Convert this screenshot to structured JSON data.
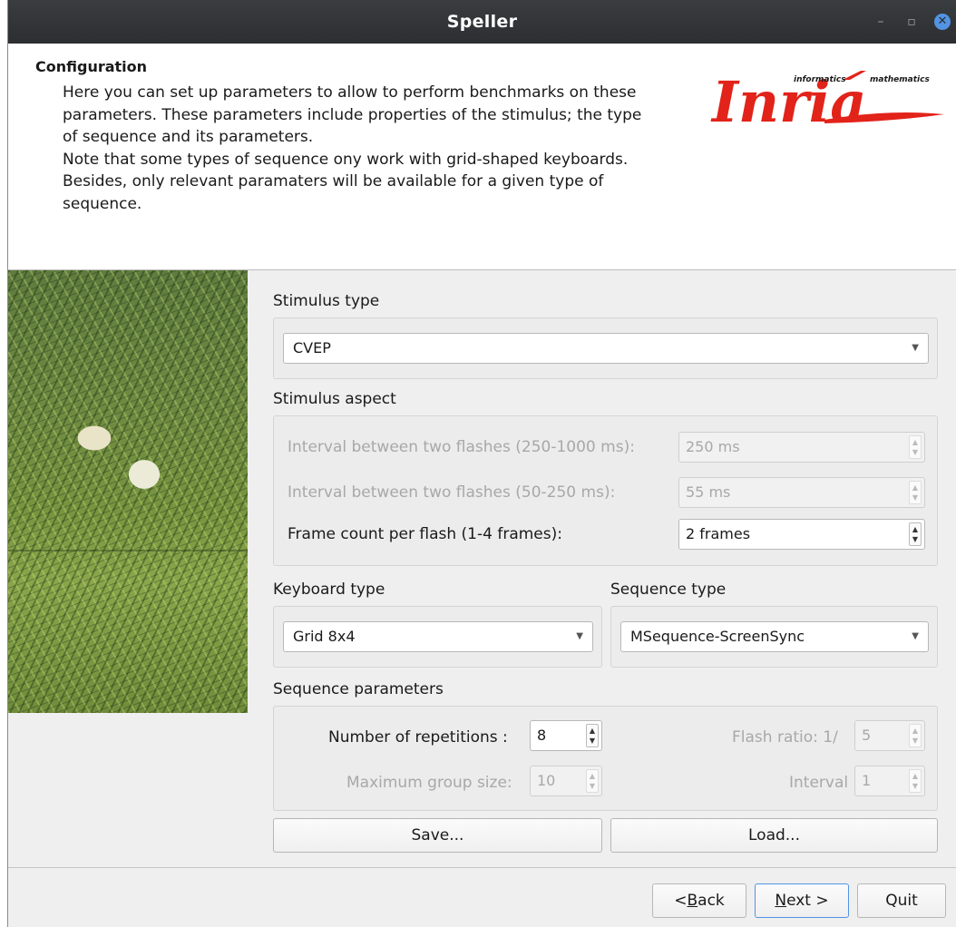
{
  "window": {
    "title": "Speller",
    "controls": {
      "minimize": "–",
      "maximize": "▫",
      "close": "✕"
    }
  },
  "header": {
    "heading": "Configuration",
    "lines": [
      "Here you can set up parameters to allow to perform benchmarks on these",
      "parameters. These parameters include properties of the stimulus; the type",
      "of sequence and its parameters.",
      "Note that some types of sequence ony work with grid-shaped keyboards.",
      "Besides, only relevant paramaters will be available for a given type of",
      "sequence."
    ],
    "logo": {
      "word": "Inria",
      "tag_left": "informatics",
      "tag_right": "mathematics",
      "color": "#e2231a"
    }
  },
  "stimulus_type": {
    "label": "Stimulus type",
    "value": "CVEP"
  },
  "stimulus_aspect": {
    "label": "Stimulus aspect",
    "rows": [
      {
        "label": "Interval between two flashes (250-1000 ms):",
        "value": "250 ms",
        "enabled": false
      },
      {
        "label": "Interval between two flashes (50-250 ms):",
        "value": "55 ms",
        "enabled": false
      },
      {
        "label": "Frame count per flash (1-4 frames):",
        "value": "2 frames",
        "enabled": true
      }
    ]
  },
  "keyboard_type": {
    "label": "Keyboard type",
    "value": "Grid 8x4"
  },
  "sequence_type": {
    "label": "Sequence type",
    "value": "MSequence-ScreenSync"
  },
  "sequence_parameters": {
    "label": "Sequence parameters",
    "repetitions": {
      "label": "Number of repetitions :",
      "value": "8",
      "enabled": true
    },
    "max_group": {
      "label": "Maximum group size:",
      "value": "10",
      "enabled": false
    },
    "flash_ratio": {
      "label": "Flash ratio: 1/",
      "value": "5",
      "enabled": false
    },
    "interval": {
      "label": "Interval",
      "value": "1",
      "enabled": false
    }
  },
  "buttons": {
    "save": "Save...",
    "load": "Load...",
    "back_prefix": "< ",
    "back_mnemonic": "B",
    "back_rest": "ack",
    "next_mnemonic": "N",
    "next_rest": "ext >",
    "quit": "Quit"
  },
  "colors": {
    "accent": "#5294e2",
    "titlebar": "#2f3235",
    "disabled_text": "#a8a8a8"
  }
}
